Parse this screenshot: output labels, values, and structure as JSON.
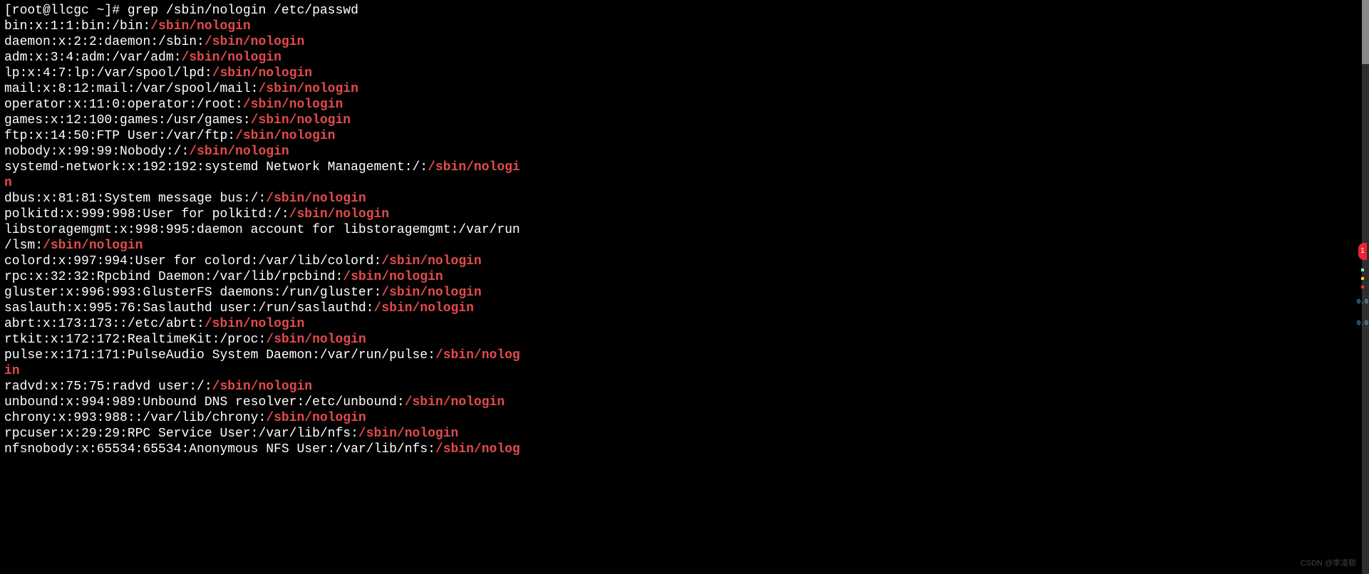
{
  "command_line": "[root@llcgc ~]# grep /sbin/nologin /etc/passwd",
  "highlight": "/sbin/nologin",
  "rows": [
    {
      "pre": "bin:x:1:1:bin:/bin:",
      "hi": "/sbin/nologin",
      "post": ""
    },
    {
      "pre": "daemon:x:2:2:daemon:/sbin:",
      "hi": "/sbin/nologin",
      "post": ""
    },
    {
      "pre": "adm:x:3:4:adm:/var/adm:",
      "hi": "/sbin/nologin",
      "post": ""
    },
    {
      "pre": "lp:x:4:7:lp:/var/spool/lpd:",
      "hi": "/sbin/nologin",
      "post": ""
    },
    {
      "pre": "mail:x:8:12:mail:/var/spool/mail:",
      "hi": "/sbin/nologin",
      "post": ""
    },
    {
      "pre": "operator:x:11:0:operator:/root:",
      "hi": "/sbin/nologin",
      "post": ""
    },
    {
      "pre": "games:x:12:100:games:/usr/games:",
      "hi": "/sbin/nologin",
      "post": ""
    },
    {
      "pre": "ftp:x:14:50:FTP User:/var/ftp:",
      "hi": "/sbin/nologin",
      "post": ""
    },
    {
      "pre": "nobody:x:99:99:Nobody:/:",
      "hi": "/sbin/nologin",
      "post": ""
    },
    {
      "pre": "systemd-network:x:192:192:systemd Network Management:/:",
      "hi": "/sbin/nologi",
      "post": "",
      "wrap_hi": "n",
      "wrap_post": ""
    },
    {
      "pre": "dbus:x:81:81:System message bus:/:",
      "hi": "/sbin/nologin",
      "post": ""
    },
    {
      "pre": "polkitd:x:999:998:User for polkitd:/:",
      "hi": "/sbin/nologin",
      "post": ""
    },
    {
      "pre": "libstoragemgmt:x:998:995:daemon account for libstoragemgmt:/var/run",
      "hi": "",
      "post": "",
      "wrap_pre": "/lsm:",
      "wrap_hi": "/sbin/nologin",
      "wrap_post": ""
    },
    {
      "pre": "colord:x:997:994:User for colord:/var/lib/colord:",
      "hi": "/sbin/nologin",
      "post": ""
    },
    {
      "pre": "rpc:x:32:32:Rpcbind Daemon:/var/lib/rpcbind:",
      "hi": "/sbin/nologin",
      "post": ""
    },
    {
      "pre": "gluster:x:996:993:GlusterFS daemons:/run/gluster:",
      "hi": "/sbin/nologin",
      "post": ""
    },
    {
      "pre": "saslauth:x:995:76:Saslauthd user:/run/saslauthd:",
      "hi": "/sbin/nologin",
      "post": ""
    },
    {
      "pre": "abrt:x:173:173::/etc/abrt:",
      "hi": "/sbin/nologin",
      "post": ""
    },
    {
      "pre": "rtkit:x:172:172:RealtimeKit:/proc:",
      "hi": "/sbin/nologin",
      "post": ""
    },
    {
      "pre": "pulse:x:171:171:PulseAudio System Daemon:/var/run/pulse:",
      "hi": "/sbin/nolog",
      "post": "",
      "wrap_hi": "in",
      "wrap_post": ""
    },
    {
      "pre": "radvd:x:75:75:radvd user:/:",
      "hi": "/sbin/nologin",
      "post": ""
    },
    {
      "pre": "unbound:x:994:989:Unbound DNS resolver:/etc/unbound:",
      "hi": "/sbin/nologin",
      "post": ""
    },
    {
      "pre": "chrony:x:993:988::/var/lib/chrony:",
      "hi": "/sbin/nologin",
      "post": ""
    },
    {
      "pre": "rpcuser:x:29:29:RPC Service User:/var/lib/nfs:",
      "hi": "/sbin/nologin",
      "post": ""
    },
    {
      "pre": "nfsnobody:x:65534:65534:Anonymous NFS User:/var/lib/nfs:",
      "hi": "/sbin/nolog",
      "post": ""
    }
  ],
  "sidebar": {
    "badge": "1",
    "values": [
      "0.0",
      "0.0"
    ]
  },
  "watermark": "CSDN @李凌聪"
}
